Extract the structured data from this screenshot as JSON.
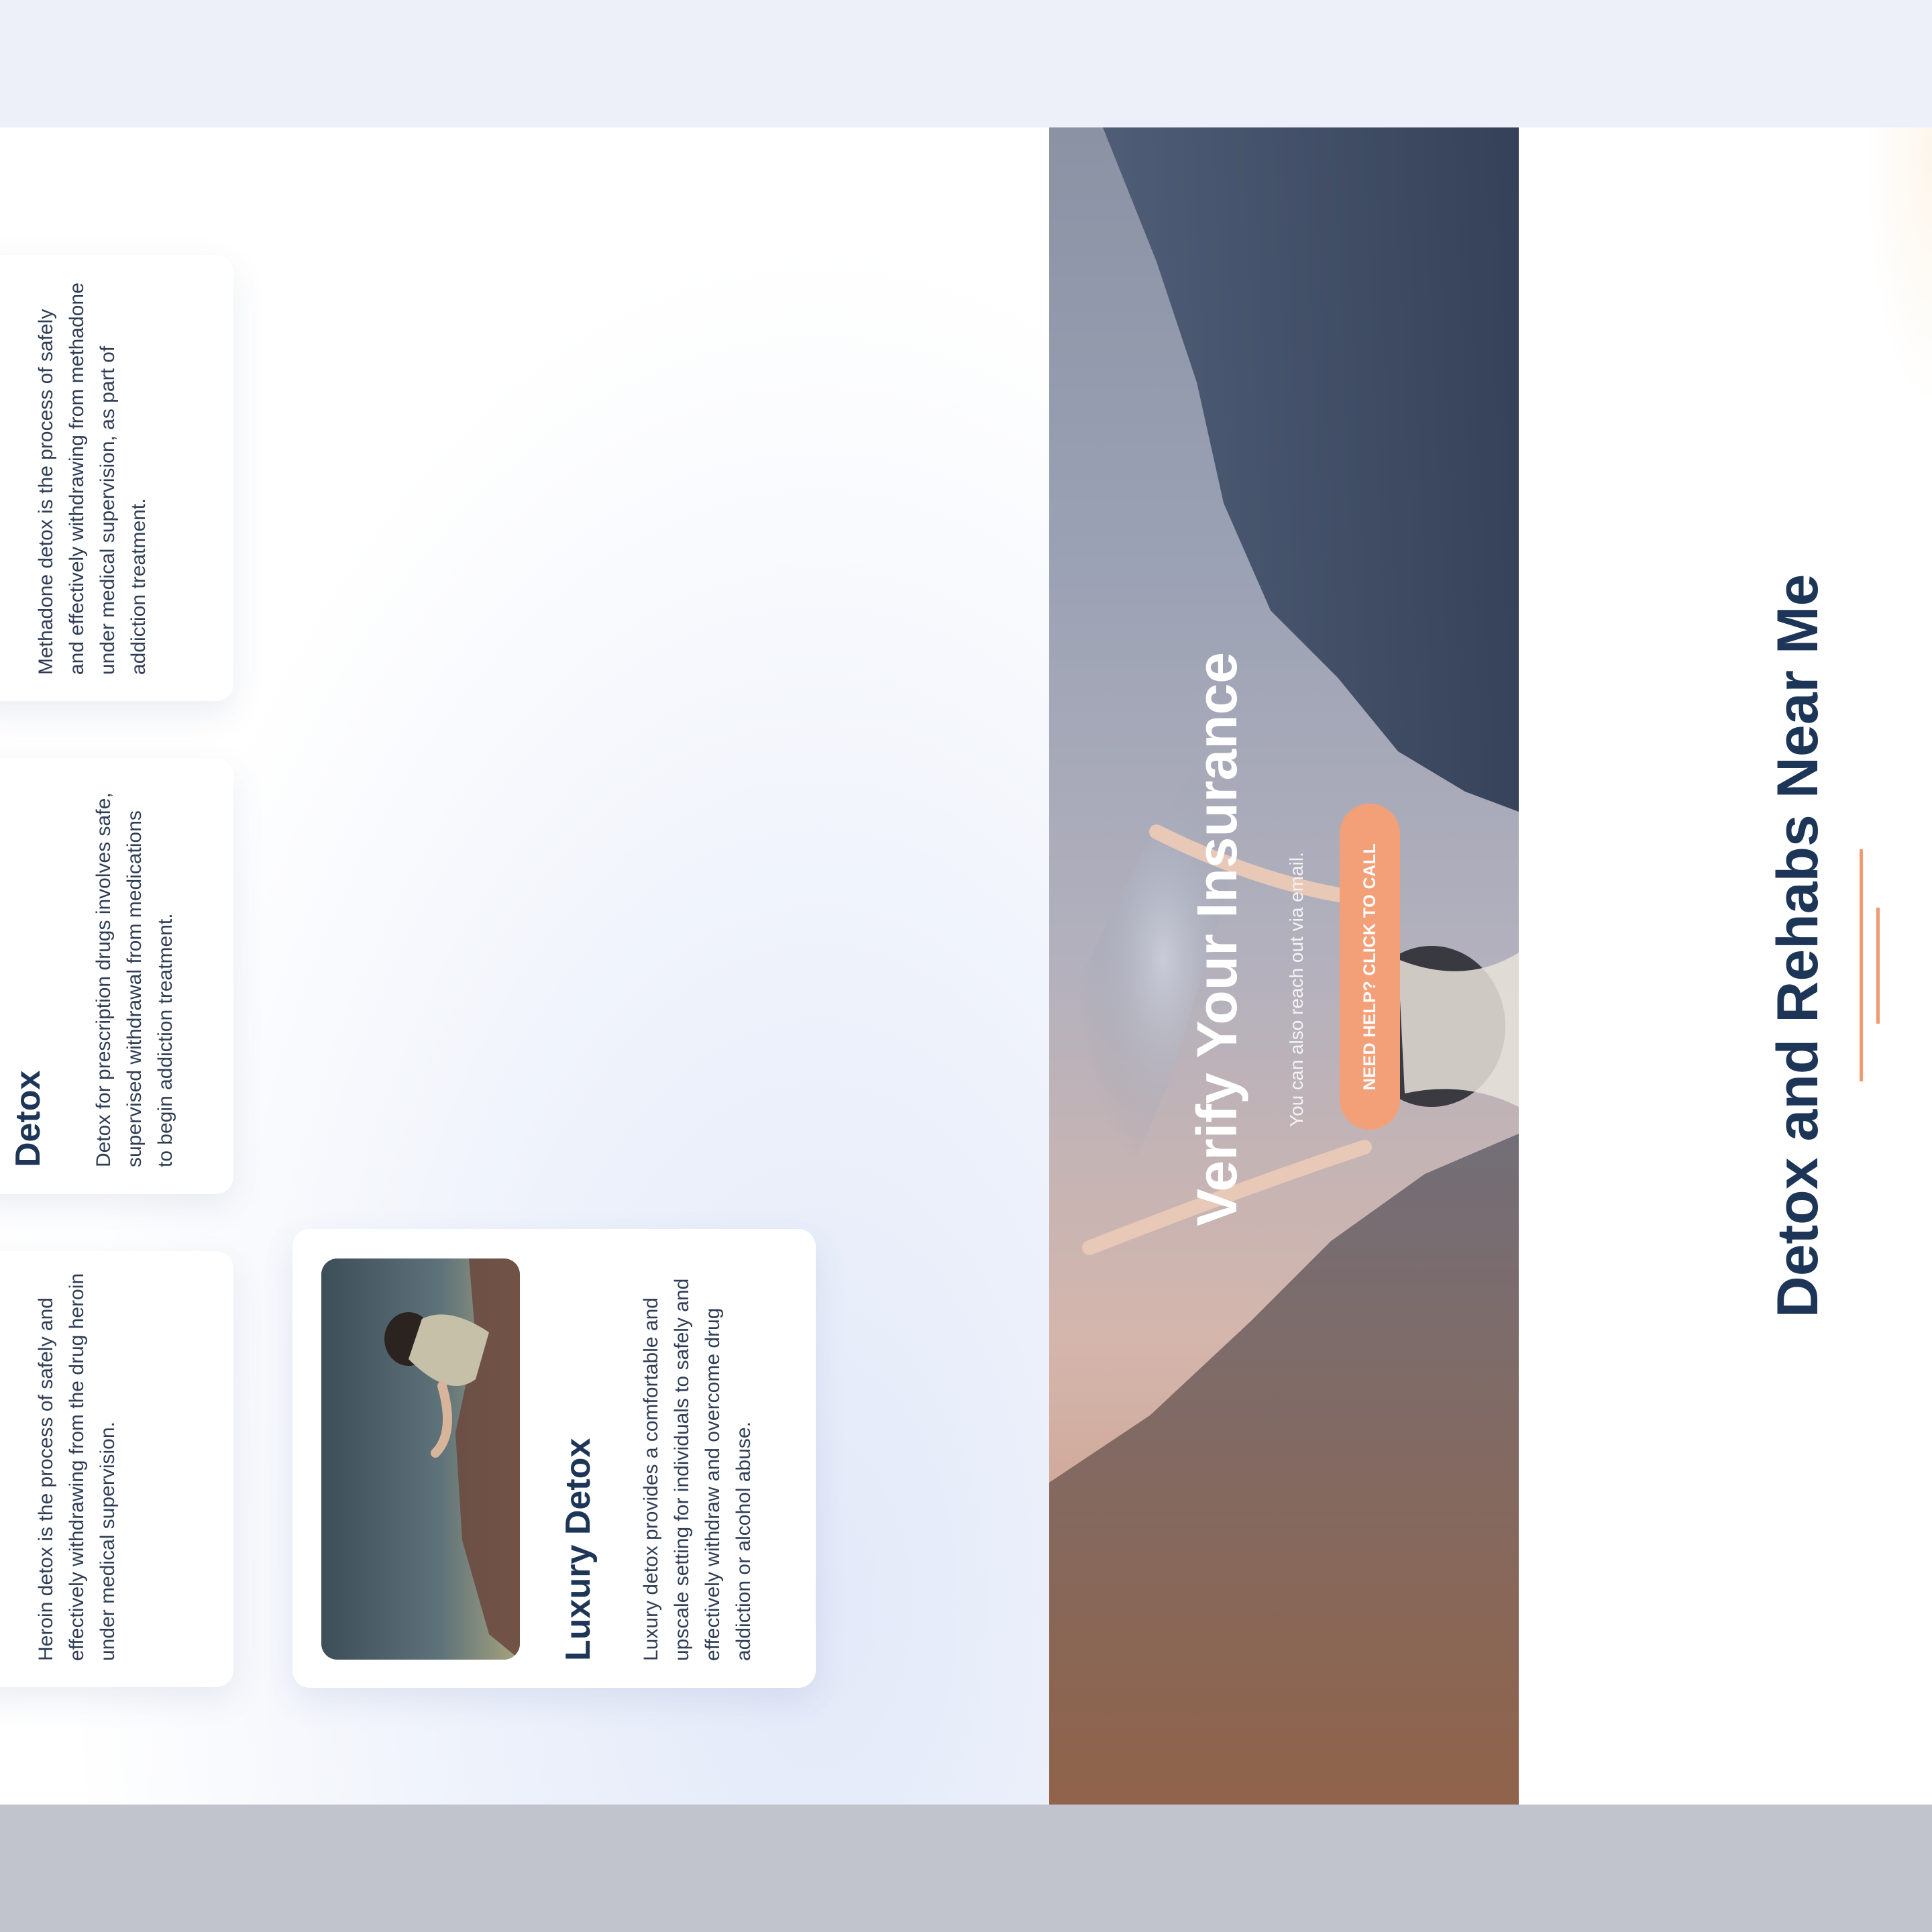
{
  "section": {
    "heading": "Detox and Rehabs Near Me"
  },
  "banner": {
    "title": "Verify Your Insurance",
    "subtitle": "You can also reach out via email.",
    "cta_label": "NEED HELP? CLICK TO CALL"
  },
  "cards": {
    "methadone": {
      "text": "Methadone detox is the process of safely and effectively withdrawing from methadone under medical supervision, as part of addiction treatment."
    },
    "prescription": {
      "title": "Detox",
      "text": "Detox for prescription drugs involves safe, supervised withdrawal from medications to begin addiction treatment."
    },
    "heroin": {
      "text": "Heroin detox is the process of safely and effectively withdrawing from the drug heroin under medical supervision."
    },
    "luxury": {
      "title": "Luxury Detox",
      "text": "Luxury detox provides a comfortable and upscale setting for individuals to safely and effectively withdraw and overcome drug addiction or alcohol abuse."
    }
  },
  "colors": {
    "heading": "#1d3557",
    "accent": "#ef9b70",
    "cta": "#f3a079",
    "body_text": "#2f3d55"
  },
  "images": {
    "banner_photo": "woman-mountain-arms-outstretched",
    "luxury_photo": "woman-sitting-by-water"
  }
}
